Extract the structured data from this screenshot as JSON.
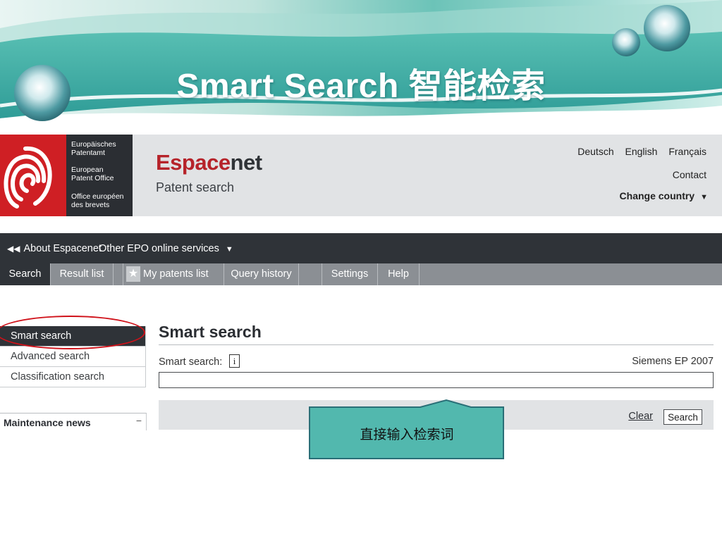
{
  "slide": {
    "title": "Smart Search 智能检索",
    "callout_text": "直接输入检索词",
    "colors": {
      "teal": "#2fa8a0",
      "callout_fill": "#52b8ae",
      "callout_border": "#2a6f77"
    }
  },
  "epo_logo": {
    "line1": "Europäisches",
    "line2": "Patentamt",
    "line3": "European",
    "line4": "Patent Office",
    "line5": "Office européen",
    "line6": "des brevets"
  },
  "header": {
    "brand_part1": "Espace",
    "brand_part2": "net",
    "subtitle": "Patent search",
    "languages": [
      "Deutsch",
      "English",
      "Français"
    ],
    "contact": "Contact",
    "change_country": "Change country",
    "colors": {
      "brand_red": "#b6232a",
      "header_bg": "#e1e3e5"
    }
  },
  "topnav": {
    "about_label": "About Espacenet",
    "other_label": "Other EPO online services"
  },
  "tabs": {
    "search": "Search",
    "result_list": "Result list",
    "my_patents": "My patents list (0)",
    "query_history": "Query history",
    "settings": "Settings",
    "help": "Help"
  },
  "left_menu": {
    "items": [
      "Smart search",
      "Advanced search",
      "Classification search"
    ],
    "active_index": 0,
    "maintenance": "Maintenance news",
    "maintenance_toggle": "−"
  },
  "main": {
    "title": "Smart search",
    "field_label": "Smart search:",
    "info_icon": "i",
    "example": "Siemens EP 2007",
    "input_value": "",
    "clear": "Clear",
    "search_button": "Search"
  }
}
